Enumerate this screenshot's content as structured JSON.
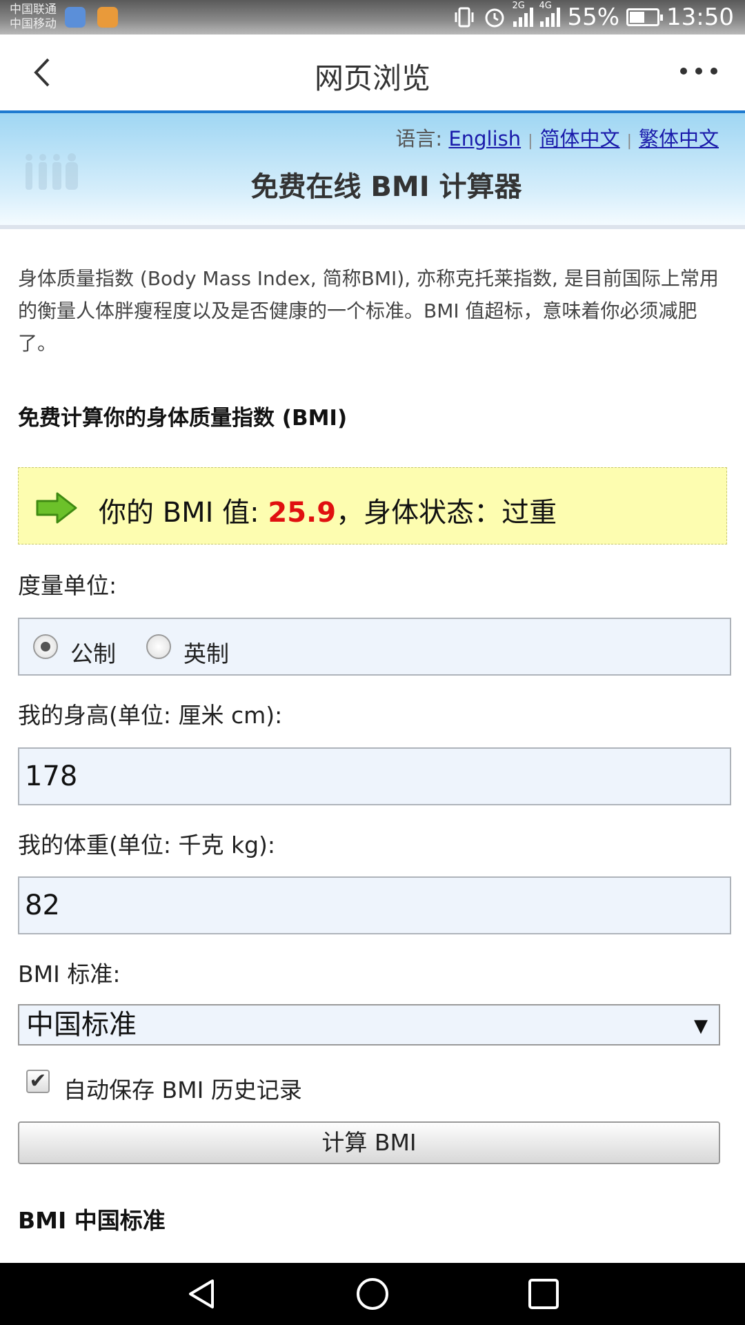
{
  "status_bar": {
    "carrier_1": "中国联通",
    "carrier_2": "中国移动",
    "network_1": "2G",
    "network_2": "4G",
    "battery": "55%",
    "time": "13:50"
  },
  "toolbar": {
    "title": "网页浏览"
  },
  "header": {
    "lang_label": "语言:",
    "lang_en": "English",
    "lang_sc": "简体中文",
    "lang_tc": "繁体中文",
    "title": "免费在线 BMI 计算器"
  },
  "content": {
    "intro": "身体质量指数 (Body Mass Index, 简称BMI), 亦称克托莱指数, 是目前国际上常用的衡量人体胖瘦程度以及是否健康的一个标准。BMI 值超标，意味着你必须减肥了。",
    "subtitle": "免费计算你的身体质量指数 (BMI)",
    "result_prefix": "你的 BMI 值: ",
    "result_value": "25.9",
    "result_suffix": "，身体状态：过重",
    "unit_label": "度量单位:",
    "unit_metric": "公制",
    "unit_imperial": "英制",
    "height_label": "我的身高(单位: 厘米 cm):",
    "height_value": "178",
    "weight_label": "我的体重(单位: 千克 kg):",
    "weight_value": "82",
    "standard_label": "BMI 标准:",
    "standard_value": "中国标准",
    "autosave_label": "自动保存 BMI 历史记录",
    "calc_button": "计算 BMI",
    "section_title": "BMI 中国标准"
  },
  "colors": {
    "result_value": "#e01010",
    "result_bg": "#fdfdb0",
    "link": "#1a1aaa",
    "input_bg": "#eef4fc"
  }
}
